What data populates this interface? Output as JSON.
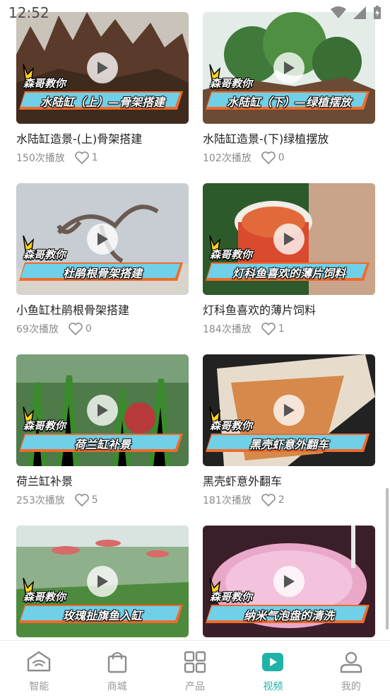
{
  "status_bar": {
    "time": "12:52"
  },
  "videos": [
    {
      "overlay_small": "森哥教你",
      "overlay_main": "水陆缸（上）—骨架搭建",
      "title": "水陆缸造景-(上)骨架搭建",
      "plays": "150次播放",
      "likes": "1"
    },
    {
      "overlay_small": "森哥教你",
      "overlay_main": "水陆缸（下）—绿植摆放",
      "title": "水陆缸造景-(下)绿植摆放",
      "plays": "102次播放",
      "likes": "0"
    },
    {
      "overlay_small": "森哥教你",
      "overlay_main": "杜鹃根骨架搭建",
      "title": "小鱼缸杜鹃根骨架搭建",
      "plays": "69次播放",
      "likes": "0"
    },
    {
      "overlay_small": "森哥教你",
      "overlay_main": "灯科鱼喜欢的薄片饲料",
      "title": "灯科鱼喜欢的薄片饲料",
      "plays": "184次播放",
      "likes": "1"
    },
    {
      "overlay_small": "森哥教你",
      "overlay_main": "荷兰缸补景",
      "title": "荷兰缸补景",
      "plays": "253次播放",
      "likes": "5"
    },
    {
      "overlay_small": "森哥教你",
      "overlay_main": "黑壳虾意外翻车",
      "title": "黑壳虾意外翻车",
      "plays": "181次播放",
      "likes": "2"
    },
    {
      "overlay_small": "森哥教你",
      "overlay_main": "玫瑰扯旗鱼入缸",
      "title": "",
      "plays": "",
      "likes": ""
    },
    {
      "overlay_small": "森哥教你",
      "overlay_main": "纳米气泡盘的清洗",
      "title": "",
      "plays": "",
      "likes": ""
    }
  ],
  "bottom_nav": [
    {
      "label": "智能",
      "icon": "smart-home-icon",
      "active": false
    },
    {
      "label": "商城",
      "icon": "shopping-bag-icon",
      "active": false
    },
    {
      "label": "产品",
      "icon": "grid-icon",
      "active": false
    },
    {
      "label": "视频",
      "icon": "video-play-icon",
      "active": true
    },
    {
      "label": "我的",
      "icon": "profile-icon",
      "active": false
    }
  ],
  "colors": {
    "accent": "#1fb2a8",
    "tag_band": "#6fd0e8",
    "tag_stripe": "#f06a2a",
    "burst": "#ffd21e"
  }
}
